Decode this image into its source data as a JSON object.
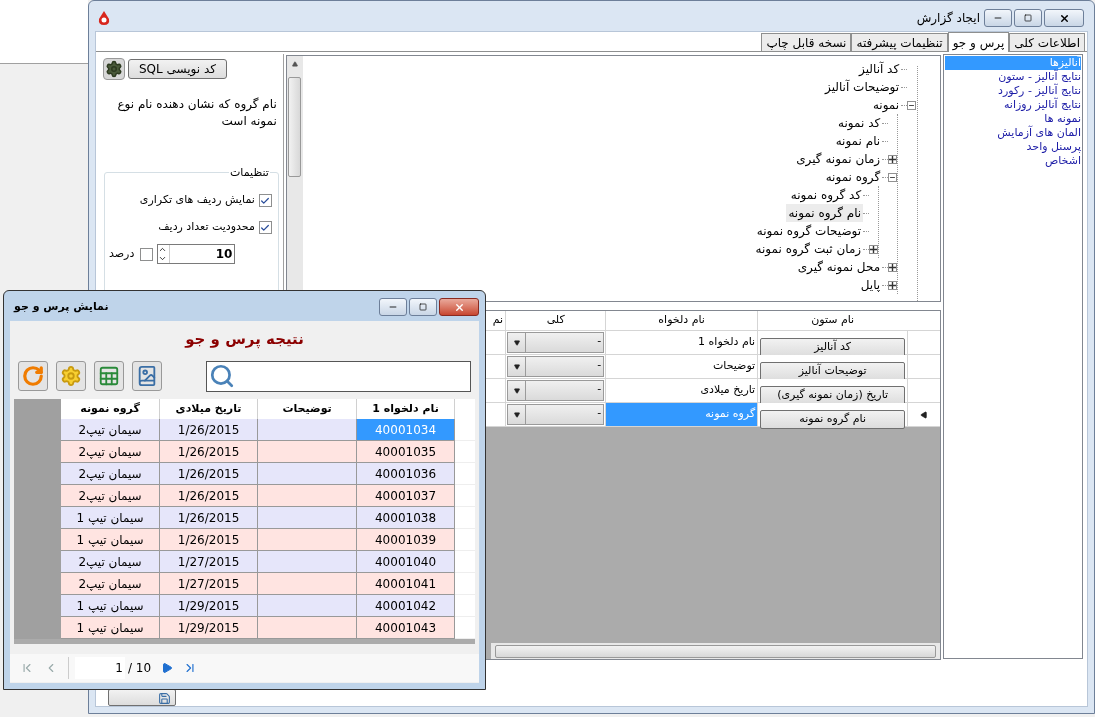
{
  "main_window": {
    "title": "ایجاد گزارش"
  },
  "tabs": [
    {
      "label": "اطلاعات کلی",
      "selected": false
    },
    {
      "label": "پرس و جو",
      "selected": true
    },
    {
      "label": "تنظیمات پیشرفته",
      "selected": false
    },
    {
      "label": "نسخه قابل چاپ",
      "selected": false
    }
  ],
  "tables_list": [
    {
      "label": "آنالیزها",
      "selected": true
    },
    {
      "label": "نتایج آنالیز - ستون",
      "selected": false
    },
    {
      "label": "نتایج آنالیز - رکورد",
      "selected": false
    },
    {
      "label": "نتایج آنالیز روزانه",
      "selected": false
    },
    {
      "label": "نمونه ها",
      "selected": false
    },
    {
      "label": "المان های آزمایش",
      "selected": false
    },
    {
      "label": "پرسنل واحد",
      "selected": false
    },
    {
      "label": "اشخاص",
      "selected": false
    }
  ],
  "field_tree": [
    {
      "label": "کد آنالیز",
      "kind": "leaf",
      "selected": false
    },
    {
      "label": "توضیحات آنالیز",
      "kind": "leaf",
      "selected": false
    },
    {
      "label": "نمونه",
      "kind": "branch",
      "expanded": true,
      "selected": false,
      "children": [
        {
          "label": "کد نمونه",
          "kind": "leaf",
          "selected": false
        },
        {
          "label": "نام نمونه",
          "kind": "leaf",
          "selected": false
        },
        {
          "label": "زمان نمونه گیری",
          "kind": "branch",
          "expanded": false,
          "selected": false
        },
        {
          "label": "گروه نمونه",
          "kind": "branch",
          "expanded": true,
          "selected": false,
          "children": [
            {
              "label": "کد گروه نمونه",
              "kind": "leaf",
              "selected": false
            },
            {
              "label": "نام گروه نمونه",
              "kind": "leaf",
              "selected": true
            },
            {
              "label": "توضیحات گروه نمونه",
              "kind": "leaf",
              "selected": false
            },
            {
              "label": "زمان ثبت گروه نمونه",
              "kind": "branch",
              "expanded": false,
              "selected": false
            }
          ]
        },
        {
          "label": "محل نمونه گیری",
          "kind": "branch",
          "expanded": false,
          "selected": false
        },
        {
          "label": "پایل",
          "kind": "branch",
          "expanded": false,
          "selected": false
        }
      ]
    }
  ],
  "sql_button": "کد نویسی SQL",
  "description": "نام گروه که نشان دهنده نام نوع نمونه است",
  "settings": {
    "title": "تنظیمات",
    "options": [
      {
        "label": "نمایش ردیف های تکراری",
        "checked": true
      },
      {
        "label": "محدودیت تعداد ردیف",
        "checked": true
      }
    ],
    "row_limit": "10",
    "percent": {
      "label": "درصد",
      "checked": false
    }
  },
  "columns_grid": {
    "headers": [
      "نام ستون",
      "نام دلخواه",
      "کلی",
      "نم"
    ],
    "rows": [
      {
        "column": "کد آنالیز",
        "alias": "نام دلخواه 1",
        "aggregate": "-",
        "selected": false
      },
      {
        "column": "توضیحات آنالیز",
        "alias": "توضیحات",
        "aggregate": "-",
        "selected": false
      },
      {
        "column": "تاریخ (زمان نمونه گیری)",
        "alias": "تاریخ میلادی",
        "aggregate": "-",
        "selected": false
      },
      {
        "column": "نام گروه نمونه",
        "alias": "گروه نمونه",
        "aggregate": "-",
        "selected": true
      }
    ]
  },
  "result_window": {
    "title": "نمایش پرس و جو",
    "heading": "نتیجه پرس و جو",
    "columns": [
      "نام دلخواه 1",
      "توضیحات",
      "تاریخ میلادی",
      "گروه نمونه"
    ],
    "rows": [
      {
        "code": "40001034",
        "date": "1/26/2015",
        "group": "سیمان تیپ2",
        "selected": true
      },
      {
        "code": "40001035",
        "date": "1/26/2015",
        "group": "سیمان تیپ2",
        "selected": false
      },
      {
        "code": "40001036",
        "date": "1/26/2015",
        "group": "سیمان تیپ2",
        "selected": false
      },
      {
        "code": "40001037",
        "date": "1/26/2015",
        "group": "سیمان تیپ2",
        "selected": false
      },
      {
        "code": "40001038",
        "date": "1/26/2015",
        "group": "سیمان تیپ 1",
        "selected": false
      },
      {
        "code": "40001039",
        "date": "1/26/2015",
        "group": "سیمان تیپ 1",
        "selected": false
      },
      {
        "code": "40001040",
        "date": "1/27/2015",
        "group": "سیمان تیپ2",
        "selected": false
      },
      {
        "code": "40001041",
        "date": "1/27/2015",
        "group": "سیمان تیپ2",
        "selected": false
      },
      {
        "code": "40001042",
        "date": "1/29/2015",
        "group": "سیمان تیپ 1",
        "selected": false
      },
      {
        "code": "40001043",
        "date": "1/29/2015",
        "group": "سیمان تیپ 1",
        "selected": false
      }
    ],
    "page": "1",
    "page_total": "/ 10"
  }
}
